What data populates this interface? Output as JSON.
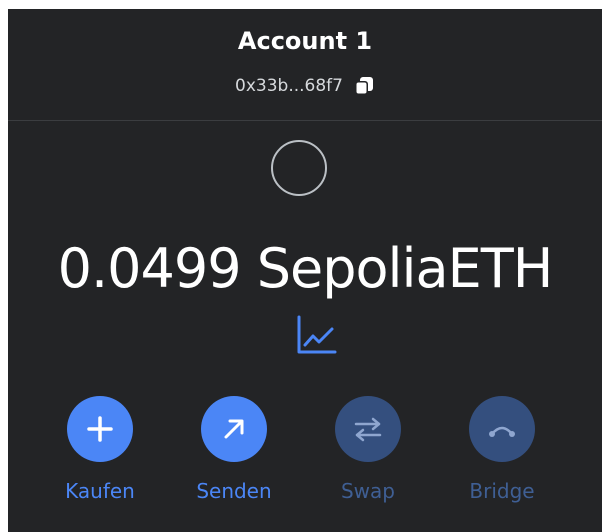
{
  "account": {
    "name": "Account 1",
    "address": "0x33b...68f7"
  },
  "balance": {
    "text": "0.0499 SepoliaETH"
  },
  "icons": {
    "copy": "copy-icon",
    "network": "network-placeholder-icon",
    "portfolio": "chart-line-icon"
  },
  "actions": [
    {
      "label": "Kaufen",
      "icon": "plus-icon",
      "enabled": true
    },
    {
      "label": "Senden",
      "icon": "arrow-up-right-icon",
      "enabled": true
    },
    {
      "label": "Swap",
      "icon": "swap-arrows-icon",
      "enabled": false
    },
    {
      "label": "Bridge",
      "icon": "bridge-icon",
      "enabled": false
    }
  ],
  "colors": {
    "background": "#232426",
    "accent": "#4b86f6",
    "disabled": "#344f7e"
  }
}
